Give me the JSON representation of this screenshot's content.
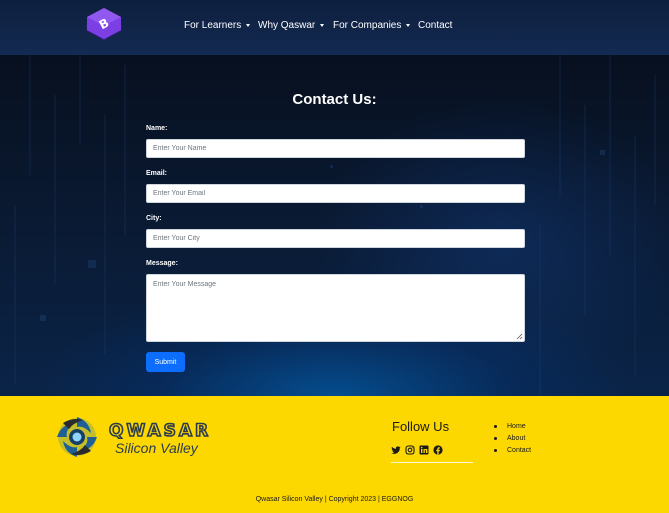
{
  "nav": {
    "items": [
      {
        "label": "For Learners",
        "dropdown": true
      },
      {
        "label": "Why Qaswar",
        "dropdown": true
      },
      {
        "label": "For Companies",
        "dropdown": true
      },
      {
        "label": "Contact",
        "dropdown": false
      }
    ],
    "brand_icon": "bootstrap-logo-icon",
    "brand_color": "#7b3fe4"
  },
  "contact": {
    "title": "Contact Us:",
    "fields": {
      "name": {
        "label": "Name:",
        "placeholder": "Enter Your Name"
      },
      "email": {
        "label": "Email:",
        "placeholder": "Enter Your Email"
      },
      "city": {
        "label": "City:",
        "placeholder": "Enter Your City"
      },
      "message": {
        "label": "Message:",
        "placeholder": "Enter Your Message"
      }
    },
    "submit_label": "Submit",
    "accent": "#0d6efd"
  },
  "footer": {
    "logo_icon": "qwasar-logo-icon",
    "logo_text": "QWASAR",
    "logo_subtext": "Silicon Valley",
    "follow_title": "Follow Us",
    "social_icons": [
      "twitter-icon",
      "instagram-icon",
      "linkedin-icon",
      "facebook-icon"
    ],
    "links": [
      "Home",
      "About",
      "Contact"
    ],
    "copyright": "Qwasar Silicon Valley | Copyright 2023 | EGGNOG",
    "background": "#fdd800"
  }
}
